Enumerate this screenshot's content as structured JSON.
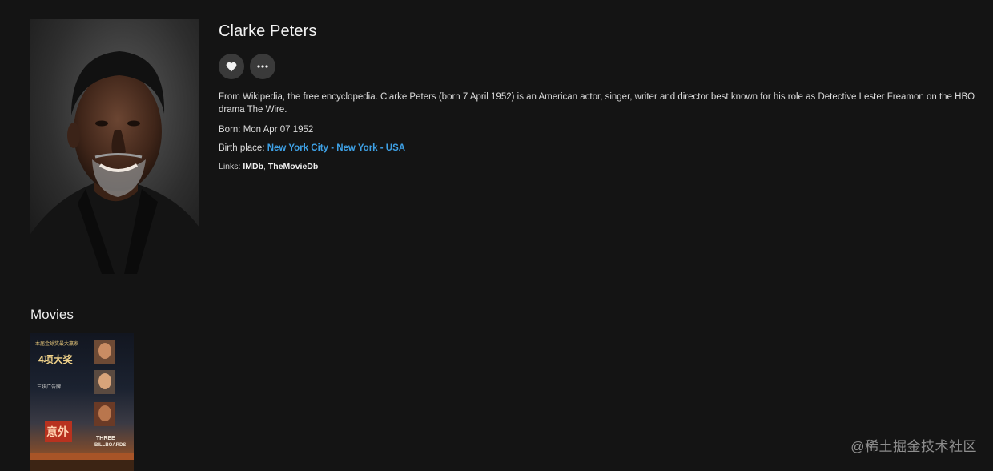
{
  "person": {
    "name": "Clarke Peters",
    "overview": "From Wikipedia, the free encyclopedia. Clarke Peters (born 7 April 1952) is an American actor, singer, writer and director best known for his role as Detective Lester Freamon on the HBO drama The Wire.",
    "born_label": "Born:",
    "born_value": "Mon Apr 07 1952",
    "birthplace_label": "Birth place:",
    "birthplace_value": "New York City - New York - USA",
    "links_label": "Links:",
    "links": [
      "IMDb",
      "TheMovieDb"
    ]
  },
  "actions": {
    "favorite_icon": "heart-icon",
    "more_icon": "more-icon"
  },
  "movies": {
    "title": "Movies",
    "items": [
      {
        "poster_lines": [
          "本届金球奖最大赢家",
          "4项大奖",
          "三块广告牌",
          "THREE",
          "BILLBOARDS",
          "意外"
        ]
      }
    ]
  },
  "watermark": "@稀土掘金技术社区",
  "colors": {
    "background": "#141414",
    "accent_link": "#3ea1e6",
    "button_bg": "#3a3a3a"
  }
}
